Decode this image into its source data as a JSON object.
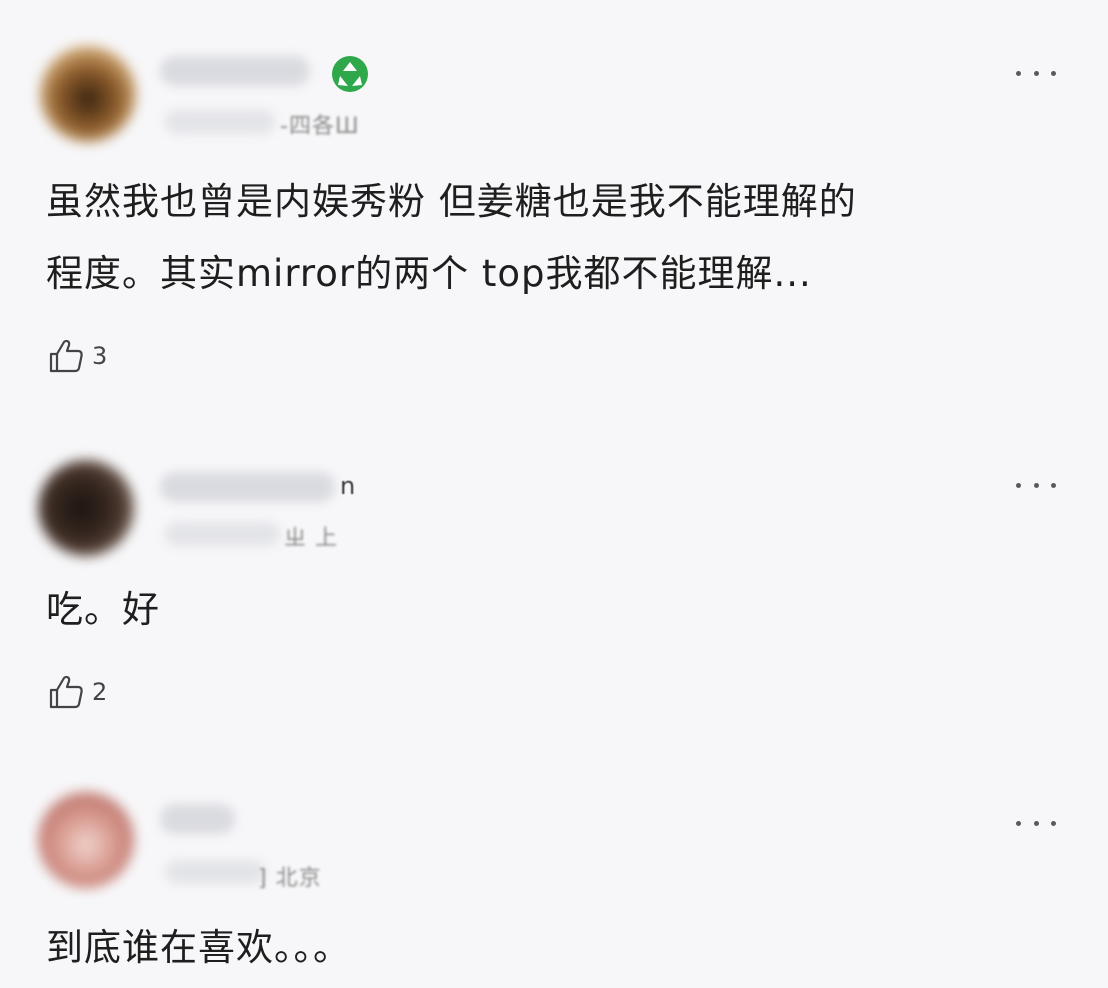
{
  "comments": [
    {
      "name_suffix": "",
      "location": "-四各Ш",
      "text_line1": "虽然我也曾是内娱秀粉 但姜糖也是我不能理解的",
      "text_line2": "程度。其实mirror的两个 top我都不能理解...",
      "likes": "3",
      "avatar_color": "#8a5a2a"
    },
    {
      "name_suffix": "n",
      "location": "ㄓ 上",
      "text_line1": "吃。好",
      "text_line2": "",
      "likes": "2",
      "avatar_color": "#3a2a22"
    },
    {
      "name_suffix": "",
      "location": "] 北京",
      "text_line1": "到底谁在喜欢。。。",
      "text_line2": "",
      "likes": "",
      "avatar_color": "#c98a80"
    }
  ],
  "colors": {
    "badge": "#2ea84a",
    "background": "#f7f7f9"
  },
  "icons": {
    "badge": "recycle-badge-icon",
    "more": "more-dots-icon",
    "like": "thumbs-up-icon"
  }
}
